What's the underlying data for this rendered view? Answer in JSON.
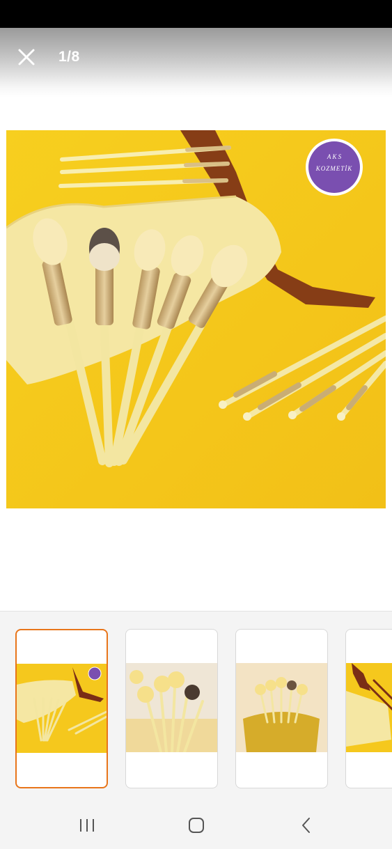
{
  "viewer": {
    "counter": "1/8",
    "close_icon": "close-icon"
  },
  "main_image": {
    "description_icon": "product-photo",
    "badge": {
      "line1": "A K S",
      "line2": "KOZMETİK",
      "color": "#7a4fb0"
    },
    "background_color": "#f6cb1e"
  },
  "thumbnails": [
    {
      "index": 1,
      "selected": true,
      "accent": "#e8751a"
    },
    {
      "index": 2,
      "selected": false
    },
    {
      "index": 3,
      "selected": false
    },
    {
      "index": 4,
      "selected": false
    }
  ],
  "nav_bar": {
    "recents_icon": "recents-icon",
    "home_icon": "home-icon",
    "back_icon": "back-icon"
  }
}
